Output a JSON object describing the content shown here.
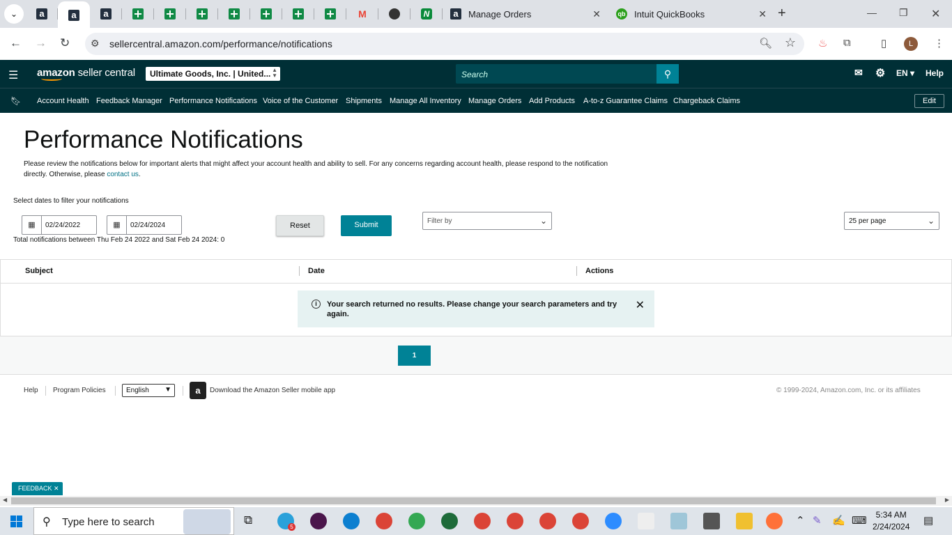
{
  "browser": {
    "tabs": [
      {
        "icon": "amazon-icon",
        "title": "Manage Orders"
      },
      {
        "icon": "quickbooks-icon",
        "title": "Intuit QuickBooks"
      }
    ],
    "url": "sellercentral.amazon.com/performance/notifications",
    "profile_initial": "L"
  },
  "header": {
    "logo_text": "amazon",
    "logo_suffix": "seller central",
    "account": "Ultimate Goods, Inc. | United...",
    "search_placeholder": "Search",
    "lang": "EN ▾",
    "help": "Help"
  },
  "nav": {
    "items": [
      "Account Health",
      "Feedback Manager",
      "Performance Notifications",
      "Voice of the Customer",
      "Shipments",
      "Manage All Inventory",
      "Manage Orders",
      "Add Products",
      "A-to-z Guarantee Claims",
      "Chargeback Claims"
    ],
    "edit": "Edit"
  },
  "page": {
    "title": "Performance Notifications",
    "description": "Please review the notifications below for important alerts that might affect your account health and ability to sell. For any concerns regarding account health, please respond to the notification directly. Otherwise, please",
    "contact_link": "contact us",
    "filter_label": "Select dates to filter your notifications",
    "start_date": "02/24/2022",
    "end_date": "02/24/2024",
    "reset": "Reset",
    "submit": "Submit",
    "filter_by": "Filter by",
    "per_page": "25 per page",
    "total": "Total notifications between Thu Feb 24 2022 and Sat Feb 24 2024: 0"
  },
  "table": {
    "headers": [
      "Subject",
      "Date",
      "Actions"
    ],
    "empty_message": "Your search returned no results. Please change your search parameters and try again."
  },
  "pager": {
    "current": "1"
  },
  "footer": {
    "help": "Help",
    "policies": "Program Policies",
    "language": "English",
    "download": "Download the Amazon Seller mobile app",
    "copyright": "© 1999-2024, Amazon.com, Inc. or its affiliates"
  },
  "feedback": "FEEDBACK",
  "taskbar": {
    "search_placeholder": "Type here to search",
    "time": "5:34 AM",
    "date": "2/24/2024",
    "telegram_badge": "5"
  }
}
